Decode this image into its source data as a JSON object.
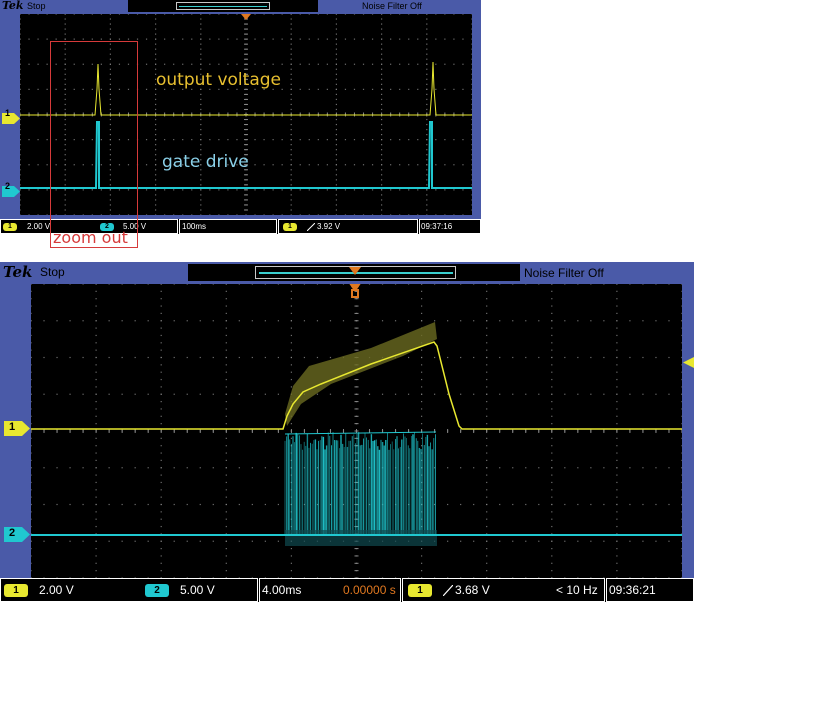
{
  "colors": {
    "ch1": "#e8e830",
    "ch2": "#20c8d0",
    "frame": "#4a5aa8",
    "accent": "#e07820",
    "annotation": "#d63a3a"
  },
  "icons": {
    "trigger": "trigger-arrow-icon",
    "channel_marker": "channel-marker-icon",
    "edge": "rising-edge-icon"
  },
  "top_scope": {
    "logo": "Tek",
    "state": "Stop",
    "noise_filter": "Noise Filter Off",
    "channel_labels": [
      "1",
      "2"
    ],
    "labels": {
      "output": "output voltage",
      "gate": "gate drive"
    },
    "readout": {
      "ch1_num": "1",
      "ch1_scale": "2.00 V",
      "ch2_num": "2",
      "ch2_scale": "5.00 V",
      "timebase": "100ms",
      "trig_chan": "1",
      "trig_level": "3.92 V",
      "time": "09:37:16"
    }
  },
  "bottom_scope": {
    "logo": "Tek",
    "state": "Stop",
    "noise_filter": "Noise Filter Off",
    "channel_labels": [
      "1",
      "2"
    ],
    "readout": {
      "ch1_num": "1",
      "ch1_scale": "2.00 V",
      "ch2_num": "2",
      "ch2_scale": "5.00 V",
      "timebase": "4.00ms",
      "position": "0.00000 s",
      "trig_chan": "1",
      "trig_level": "3.68 V",
      "freq": "< 10 Hz",
      "time": "09:36:21"
    }
  },
  "annotation": {
    "zoom": "zoom out"
  }
}
